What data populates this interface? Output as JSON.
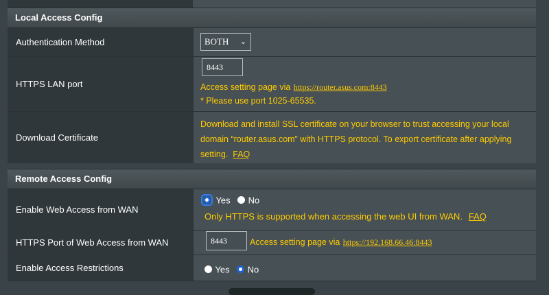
{
  "local": {
    "header": "Local Access Config",
    "auth_label": "Authentication Method",
    "auth_value": "BOTH",
    "https_port_label": "HTTPS LAN port",
    "https_port_value": "8443",
    "access_text": "Access setting page via",
    "access_link": "https://router.asus.com:8443",
    "port_note": "* Please use port 1025-65535.",
    "cert_label": "Download Certificate",
    "cert_line1": "Download and install SSL certificate on your browser to trust accessing your local",
    "cert_line2": "domain “router.asus.com” with HTTPS protocol. To export certificate after applying",
    "cert_line3": "setting.",
    "faq": "FAQ"
  },
  "remote": {
    "header": "Remote Access Config",
    "wan_label": "Enable Web Access from WAN",
    "yes": "Yes",
    "no": "No",
    "wan_note": "Only HTTPS is supported when accessing the web UI from WAN.",
    "faq": "FAQ",
    "port_label": "HTTPS Port of Web Access from WAN",
    "port_value": "8443",
    "access_text": "Access setting page via",
    "access_link": "https://192.168.66.46:8443",
    "restrict_label": "Enable Access Restrictions"
  },
  "colors": {
    "accent_yellow": "#ffcc00",
    "radio_blue": "#1a66d8"
  }
}
